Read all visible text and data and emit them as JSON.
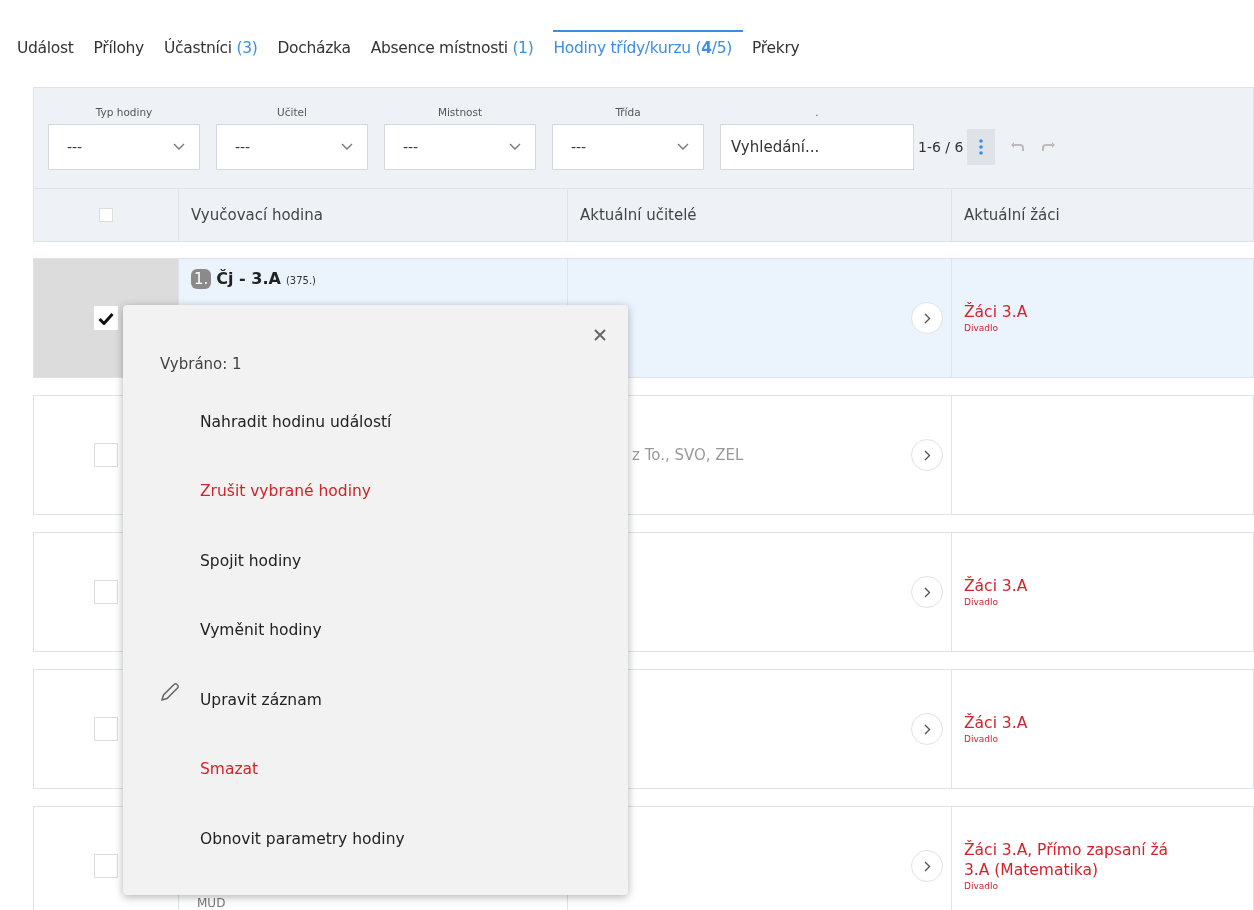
{
  "tabs": [
    {
      "label": "Událost",
      "selected": false
    },
    {
      "label": "Přílohy",
      "selected": false
    },
    {
      "label": "Účastníci",
      "count": "(3)",
      "selected": false
    },
    {
      "label": "Docházka",
      "selected": false
    },
    {
      "label": "Absence místnosti",
      "count": "(1)",
      "selected": false
    },
    {
      "label": "Hodiny třídy/kurzu",
      "count": "(**4**/5)",
      "selected": true
    },
    {
      "label": "Překry",
      "selected": false
    }
  ],
  "filters": [
    {
      "label": "Typ hodiny",
      "value": "---"
    },
    {
      "label": "Učitel",
      "value": "---"
    },
    {
      "label": "Mistnost",
      "value": "---"
    },
    {
      "label": "Třída",
      "value": "---"
    }
  ],
  "search": {
    "label": ".",
    "placeholder": "Vyhledání..."
  },
  "pager": "1-6 / 6",
  "columns": [
    "Vyučovací hodina",
    "Aktuální učitelé",
    "Aktuální žáci"
  ],
  "header_checked": false,
  "rows": [
    {
      "selected": true,
      "number": "1.",
      "title": "Čj - 3.A",
      "code": "(375.)",
      "students": [
        "Žáci 3.A"
      ],
      "note": "Divadlo"
    },
    {
      "selected": false,
      "teachers": "z To., SVO, ZEL"
    },
    {
      "selected": false,
      "students": [
        "Žáci 3.A"
      ],
      "note": "Divadlo"
    },
    {
      "selected": false,
      "students": [
        "Žáci 3.A"
      ],
      "note": "Divadlo"
    },
    {
      "selected": false,
      "students": [
        "Žáci 3.A, Přímo zapsaní žá",
        "3.A  (Matematika)"
      ],
      "note": "Divadlo",
      "footer": "MUD"
    }
  ],
  "menu": {
    "heading": "Vybráno: 1",
    "items": [
      {
        "label": "Nahradit hodinu událostí",
        "kind": "normal"
      },
      {
        "label": "Zrušit vybrané hodiny",
        "kind": "danger"
      },
      {
        "label": "Spojit hodiny",
        "kind": "normal"
      },
      {
        "label": "Vyměnit hodiny",
        "kind": "normal"
      },
      {
        "label": "Upravit záznam",
        "kind": "edit"
      },
      {
        "label": "Smazat",
        "kind": "danger"
      },
      {
        "label": "Obnovit parametry hodiny",
        "kind": "normal"
      }
    ]
  }
}
